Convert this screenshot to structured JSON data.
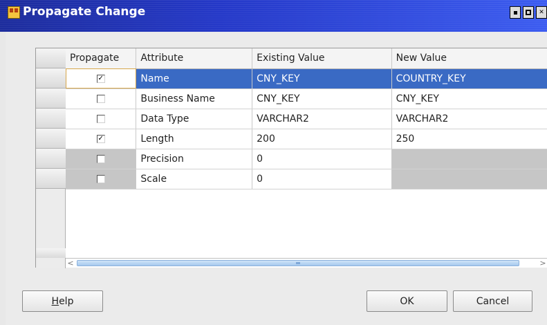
{
  "window": {
    "title": "Propagate Change"
  },
  "table": {
    "columns": [
      "Propagate",
      "Attribute",
      "Existing Value",
      "New Value"
    ],
    "rows": [
      {
        "propagate": "✓",
        "attribute": "Name",
        "existing": "CNY_KEY",
        "new": "COUNTRY_KEY"
      },
      {
        "propagate": "",
        "attribute": "Business Name",
        "existing": "CNY_KEY",
        "new": "CNY_KEY"
      },
      {
        "propagate": "",
        "attribute": "Data Type",
        "existing": "VARCHAR2",
        "new": "VARCHAR2"
      },
      {
        "propagate": "✓",
        "attribute": "Length",
        "existing": "200",
        "new": "250"
      },
      {
        "propagate": "",
        "attribute": "Precision",
        "existing": "0",
        "new": ""
      },
      {
        "propagate": "",
        "attribute": "Scale",
        "existing": "0",
        "new": ""
      }
    ],
    "scroll_left": "<",
    "scroll_right": ">"
  },
  "buttons": {
    "help_mnemonic": "H",
    "help_rest": "elp",
    "ok": "OK",
    "cancel": "Cancel"
  }
}
